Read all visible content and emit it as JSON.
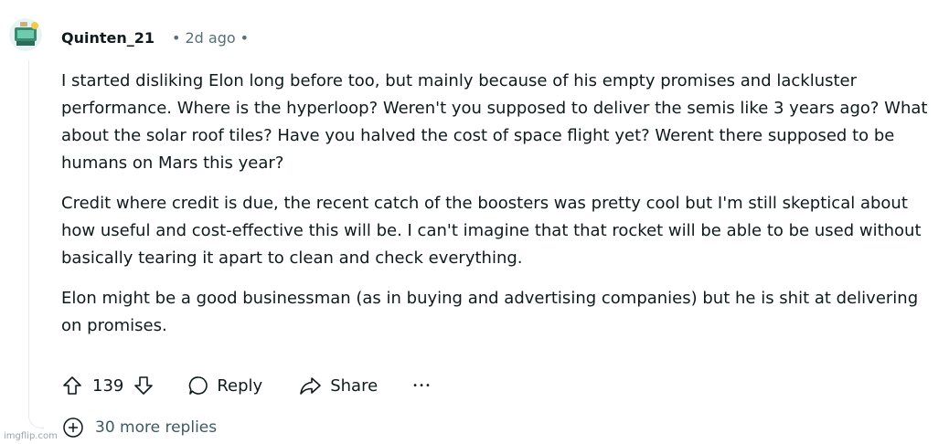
{
  "comment": {
    "username": "Quinten_21",
    "time": "2d ago",
    "paragraphs": [
      "I started disliking Elon long before too, but mainly because of his empty promises and lackluster performance. Where is the hyperloop? Weren't you supposed to deliver the semis like 3 years ago? What about the solar roof tiles? Have you halved the cost of space flight yet? Werent there supposed to be humans on Mars this year?",
      "Credit where credit is due, the recent catch of the boosters was pretty cool but I'm still skeptical about how useful and cost-effective this will be. I can't imagine that that rocket will be able to be used without basically tearing it apart to clean and check everything.",
      "Elon might be a good businessman (as in buying and advertising companies) but he is shit at delivering on promises."
    ]
  },
  "actions": {
    "vote_count": "139",
    "reply_label": "Reply",
    "share_label": "Share",
    "more_label": "•••"
  },
  "more_replies": "30 more replies",
  "watermark": "imgflip.com",
  "icons": {
    "upvote": "upvote-arrow-icon",
    "downvote": "downvote-arrow-icon",
    "reply": "speech-bubble-icon",
    "share": "share-arrow-icon",
    "expand": "plus-circle-icon"
  }
}
